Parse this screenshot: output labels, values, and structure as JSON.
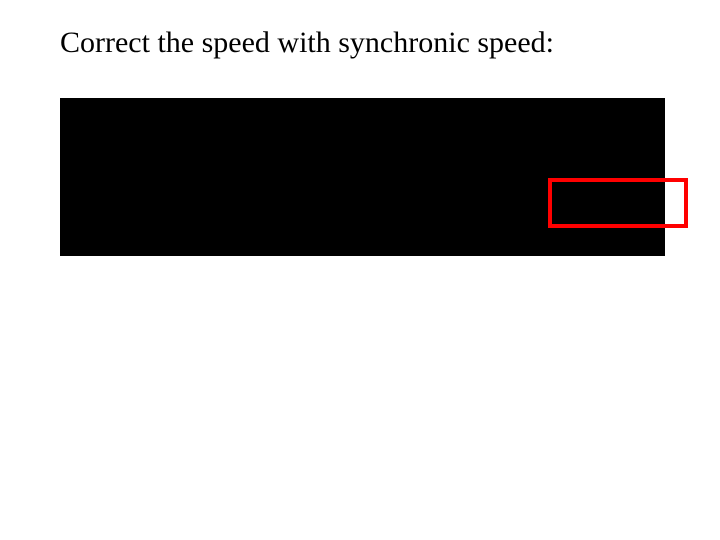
{
  "heading": {
    "text": "Correct the speed with synchronic speed:"
  }
}
